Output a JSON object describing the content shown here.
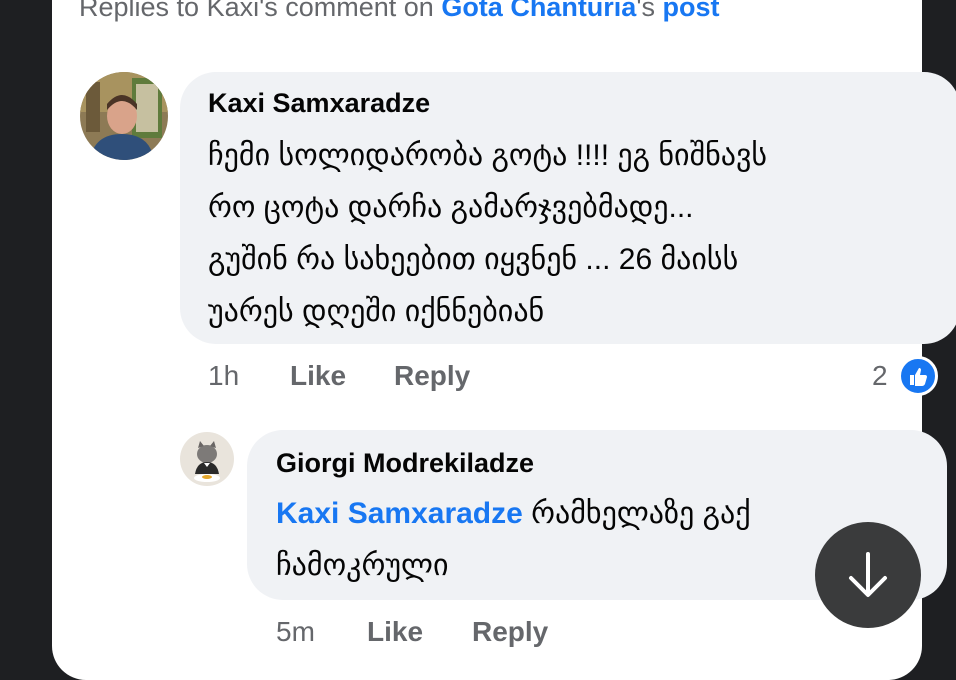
{
  "header": {
    "prefix": "Replies to Kaxi's comment on ",
    "post_owner": "Gota Chanturia",
    "suffix": "'s ",
    "post_link": "post"
  },
  "comment": {
    "author": "Kaxi Samxaradze",
    "lines": [
      "ჩემი სოლიდარობა გოტა !!!! ეგ ნიშნავს",
      "რო ცოტა დარჩა გამარჯვებმადე...",
      "გუშინ რა სახეებით იყვნენ ... 26 მაისს",
      "უარეს დღეში იქნნებიან"
    ],
    "time": "1h",
    "like_label": "Like",
    "reply_label": "Reply",
    "reaction_count": "2"
  },
  "reply": {
    "author": "Giorgi Modrekiladze",
    "mention": "Kaxi Samxaradze",
    "line1_rest": " რამხელაზე გაქ",
    "line2": "ჩამოკრული",
    "time": "5m",
    "like_label": "Like",
    "reply_label": "Reply"
  },
  "icons": {
    "like_badge": "thumbs-up-icon",
    "scroll_button": "arrow-down-icon"
  },
  "colors": {
    "link_blue": "#1877f2",
    "bubble_bg": "#f0f2f5",
    "meta_gray": "#65676b",
    "fab_bg": "#3a3b3c"
  }
}
